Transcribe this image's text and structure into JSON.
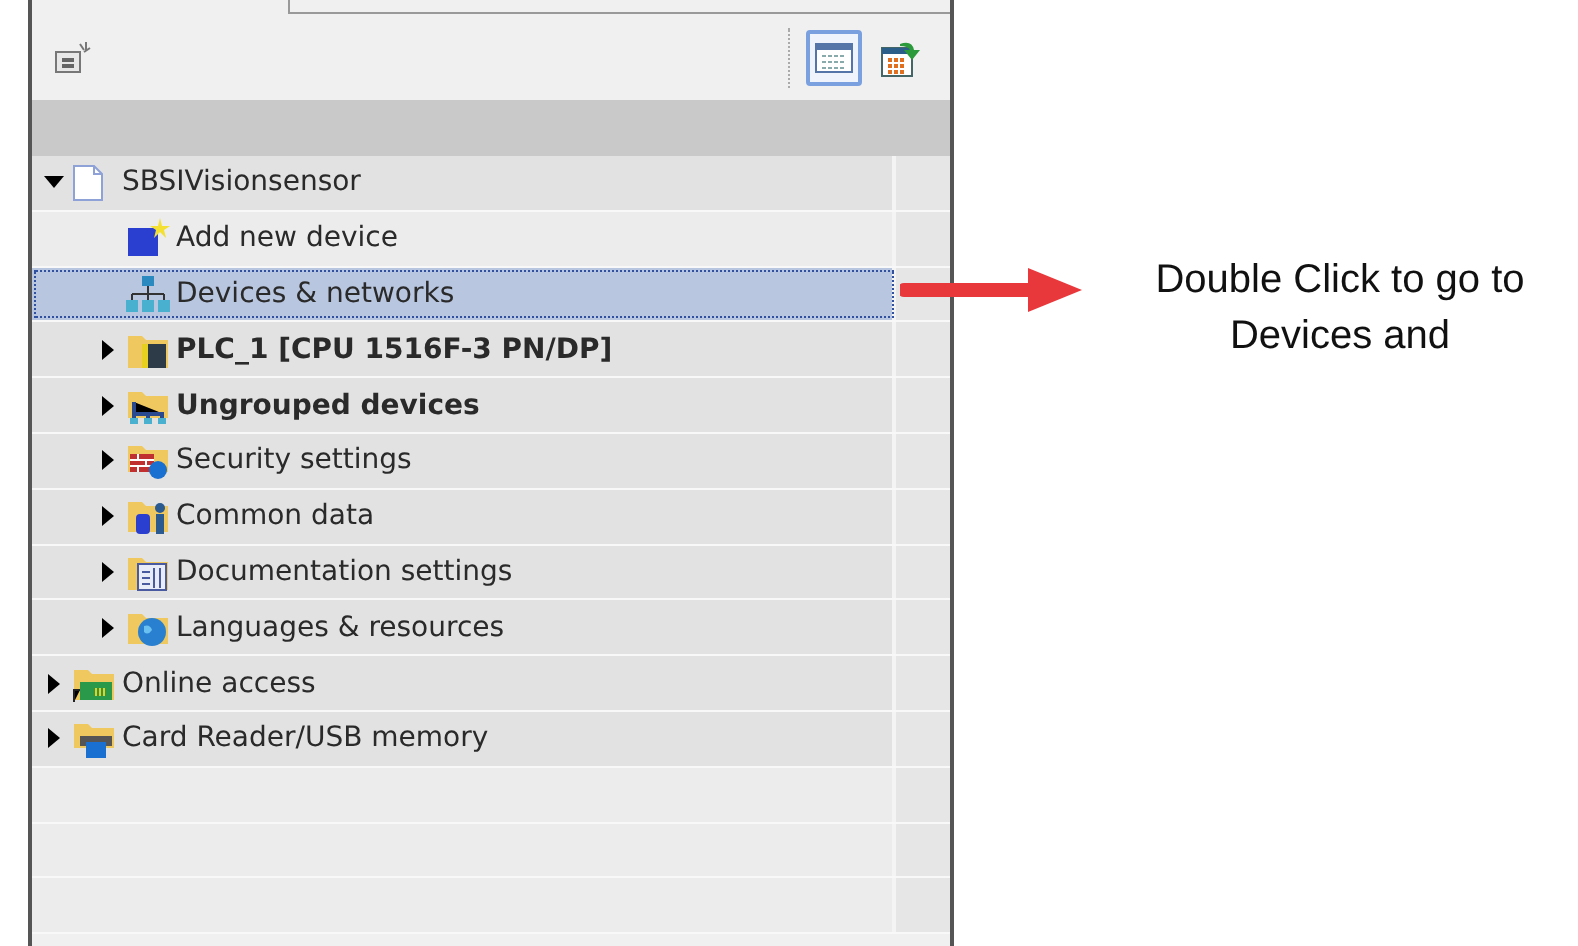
{
  "toolbar": {
    "view_buttons": [
      {
        "selected": true
      },
      {
        "selected": false
      }
    ]
  },
  "tree": [
    {
      "label": "SBSIVisionsensor",
      "kind": "project",
      "expandable": true,
      "expanded": true,
      "bold": false,
      "selected": false,
      "children": [
        {
          "label": "Add new device",
          "kind": "add-device",
          "expandable": false,
          "expanded": false,
          "bold": false,
          "selected": false
        },
        {
          "label": "Devices & networks",
          "kind": "network",
          "expandable": false,
          "expanded": false,
          "bold": false,
          "selected": true
        },
        {
          "label": "PLC_1 [CPU 1516F-3 PN/DP]",
          "kind": "plc",
          "expandable": true,
          "expanded": false,
          "bold": true,
          "selected": false
        },
        {
          "label": "Ungrouped devices",
          "kind": "ungrouped",
          "expandable": true,
          "expanded": false,
          "bold": true,
          "selected": false
        },
        {
          "label": "Security settings",
          "kind": "security",
          "expandable": true,
          "expanded": false,
          "bold": false,
          "selected": false
        },
        {
          "label": "Common data",
          "kind": "common-data",
          "expandable": true,
          "expanded": false,
          "bold": false,
          "selected": false
        },
        {
          "label": "Documentation settings",
          "kind": "documentation",
          "expandable": true,
          "expanded": false,
          "bold": false,
          "selected": false
        },
        {
          "label": "Languages & resources",
          "kind": "languages",
          "expandable": true,
          "expanded": false,
          "bold": false,
          "selected": false
        }
      ]
    },
    {
      "label": "Online access",
      "kind": "online",
      "expandable": true,
      "expanded": false,
      "bold": false,
      "selected": false
    },
    {
      "label": "Card Reader/USB memory",
      "kind": "card-reader",
      "expandable": true,
      "expanded": false,
      "bold": false,
      "selected": false
    }
  ],
  "annotation": {
    "text": "Double Click to go to Devices and"
  }
}
